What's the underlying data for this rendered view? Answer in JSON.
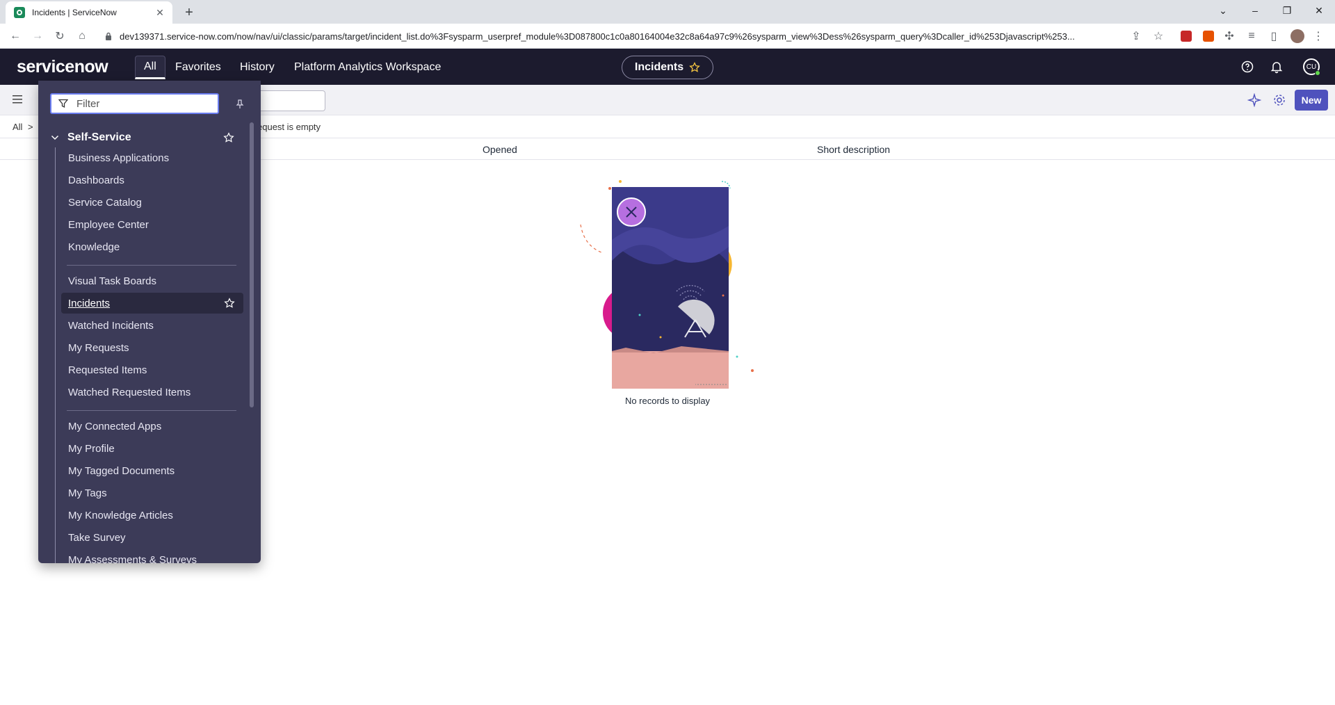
{
  "browser": {
    "tab_title": "Incidents | ServiceNow",
    "url": "dev139371.service-now.com/now/nav/ui/classic/params/target/incident_list.do%3Fsysparm_userpref_module%3D087800c1c0a80164004e32c8a64a97c9%26sysparm_view%3Dess%26sysparm_query%3Dcaller_id%253Djavascript%253..."
  },
  "header": {
    "logo": "servicenow",
    "nav": [
      "All",
      "Favorites",
      "History",
      "Platform Analytics Workspace"
    ],
    "context_pill": "Incidents",
    "avatar_initials": "CU"
  },
  "list": {
    "new_button": "New",
    "breadcrumb_all": "All",
    "breadcrumb_sep": ">",
    "breadcrumb_condition": "equest is empty",
    "columns": [
      "Opened",
      "Short description"
    ],
    "empty_message": "No records to display"
  },
  "menu": {
    "filter_placeholder": "Filter",
    "section": "Self-Service",
    "items": [
      "Business Applications",
      "Dashboards",
      "Service Catalog",
      "Employee Center",
      "Knowledge",
      "Visual Task Boards",
      "Incidents",
      "Watched Incidents",
      "My Requests",
      "Requested Items",
      "Watched Requested Items",
      "My Connected Apps",
      "My Profile",
      "My Tagged Documents",
      "My Tags",
      "My Knowledge Articles",
      "Take Survey",
      "My Assessments & Surveys"
    ],
    "active_item": "Incidents"
  },
  "colors": {
    "header_bg": "#1c1b2e",
    "menu_bg": "#3c3b58",
    "accent": "#4f52bd",
    "logo_green": "#62d84e"
  }
}
